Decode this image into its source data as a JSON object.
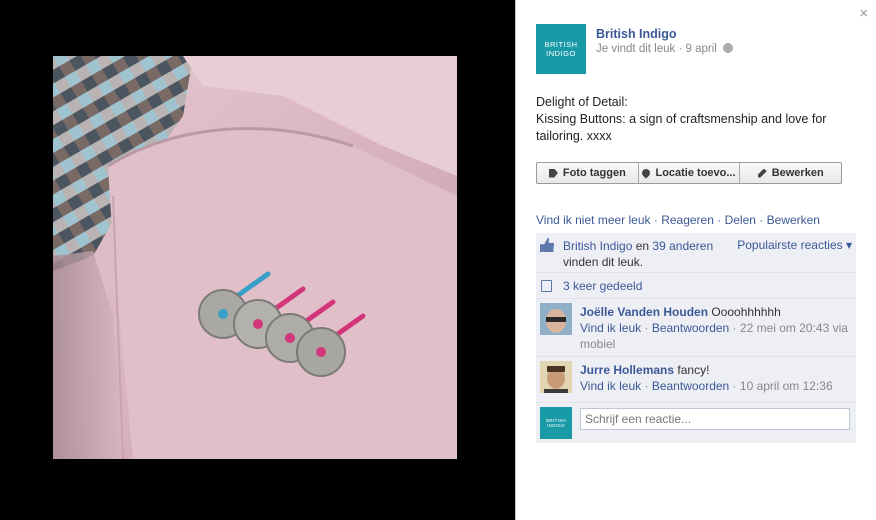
{
  "post": {
    "page_name": "British Indigo",
    "logo_line1": "BRITISH",
    "logo_line2": "INDIGO",
    "liked_status": "Je vindt dit leuk",
    "date": "9 april",
    "message": "Delight of Detail:\nKissing Buttons: a sign of craftsmenship and love for tailoring. xxxx"
  },
  "actions": {
    "tag": "Foto taggen",
    "location": "Locatie toevo...",
    "edit": "Bewerken"
  },
  "links": {
    "unlike": "Vind ik niet meer leuk",
    "comment": "Reageren",
    "share": "Delen",
    "edit": "Bewerken"
  },
  "likes": {
    "name": "British Indigo",
    "and": "en",
    "others": "39 anderen",
    "suffix": "vinden dit leuk.",
    "top_reactions": "Populairste reacties ▾"
  },
  "shares": {
    "text": "3 keer gedeeld"
  },
  "comments": [
    {
      "author": "Joëlle Vanden Houden",
      "text": "Oooohhhhhh",
      "like": "Vind ik leuk",
      "reply": "Beantwoorden",
      "meta": "22 mei om 20:43 via mobiel"
    },
    {
      "author": "Jurre Hollemans",
      "text": "fancy!",
      "like": "Vind ik leuk",
      "reply": "Beantwoorden",
      "meta": "10 april om 12:36"
    }
  ],
  "compose": {
    "placeholder": "Schrijf een reactie..."
  },
  "close": "×",
  "colors": {
    "link": "#3b5998",
    "brand": "#1a9aa6",
    "feedback_bg": "#edeff4"
  }
}
